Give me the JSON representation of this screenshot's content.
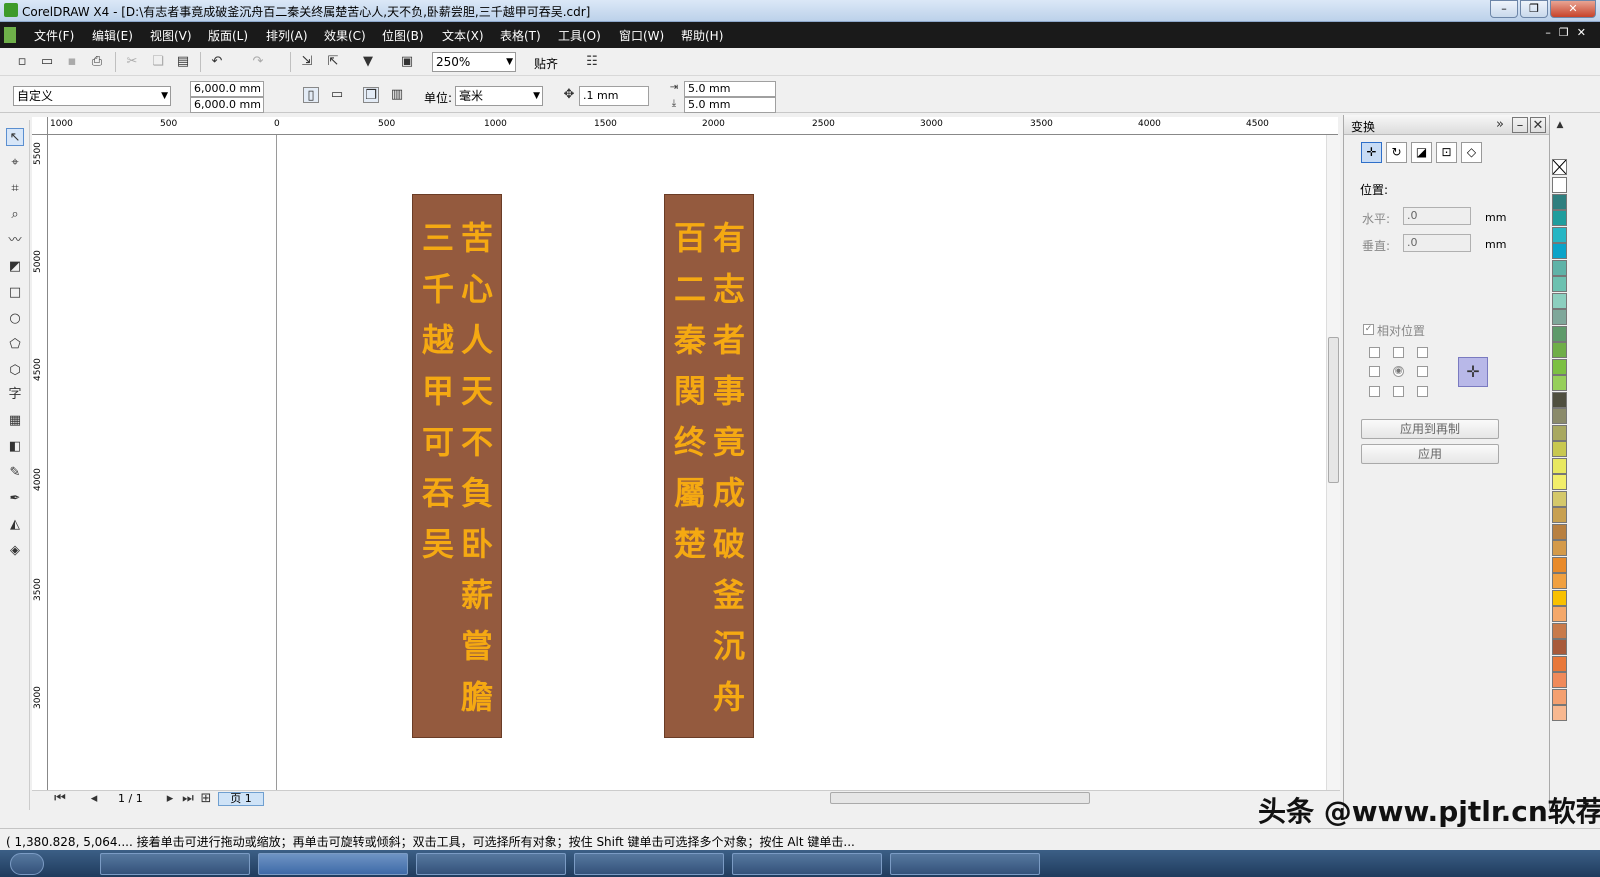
{
  "window": {
    "title": "CorelDRAW X4 - [D:\\有志者事竟成破釜沉舟百二秦关终属楚苦心人,天不负,卧薪尝胆,三千越甲可吞吴.cdr]"
  },
  "menu": [
    "文件(F)",
    "编辑(E)",
    "视图(V)",
    "版面(L)",
    "排列(A)",
    "效果(C)",
    "位图(B)",
    "文本(X)",
    "表格(T)",
    "工具(O)",
    "窗口(W)",
    "帮助(H)"
  ],
  "toolbar": {
    "zoom": "250%",
    "snap_label": "贴齐"
  },
  "property_bar": {
    "paper_preset": "自定义",
    "width": "6,000.0 mm",
    "height": "6,000.0 mm",
    "units_label": "单位:",
    "units": "毫米",
    "nudge": ".1 mm",
    "dup_x": "5.0 mm",
    "dup_y": "5.0 mm"
  },
  "ruler_h": [
    "1000",
    "500",
    "0",
    "500",
    "1000",
    "1500",
    "2000",
    "2500",
    "3000",
    "3500",
    "4000",
    "4500"
  ],
  "ruler_v": [
    "5500",
    "5000",
    "4500",
    "4000",
    "3500",
    "3000"
  ],
  "couplet_left": {
    "col_right": [
      "苦",
      "心",
      "人",
      "天",
      "不",
      "負",
      "卧",
      "薪",
      "嘗",
      "膽"
    ],
    "col_left": [
      "三",
      "千",
      "越",
      "甲",
      "可",
      "吞",
      "吴"
    ]
  },
  "couplet_right": {
    "col_right": [
      "有",
      "志",
      "者",
      "事",
      "竟",
      "成",
      "破",
      "釜",
      "沉",
      "舟"
    ],
    "col_left": [
      "百",
      "二",
      "秦",
      "関",
      "终",
      "屬",
      "楚"
    ]
  },
  "page_nav": {
    "page_count": "1 / 1",
    "page_tab": "页 1"
  },
  "docker": {
    "title": "变换",
    "position_label": "位置:",
    "h_label": "水平:",
    "h_value": ".0",
    "v_label": "垂直:",
    "v_value": ".0",
    "unit": "mm",
    "relative_label": "相对位置",
    "apply_dup": "应用到再制",
    "apply": "应用"
  },
  "palette_colors": [
    "#ffffff",
    "#2e7f7f",
    "#1f9d9d",
    "#26b6c4",
    "#0aa3c8",
    "#5fb3a8",
    "#6cc1b0",
    "#8ccfbf",
    "#7fa79a",
    "#5e9a6a",
    "#6fae48",
    "#7cc043",
    "#96cf5a",
    "#4f4f3f",
    "#8a8a6a",
    "#a8a860",
    "#c8c850",
    "#e8e860",
    "#f2ee6a",
    "#d4c86a",
    "#c8a050",
    "#b88040",
    "#d49a4a",
    "#e88a2a",
    "#f0a040",
    "#f8c000",
    "#f4a86a",
    "#c87a4a",
    "#a85a3a",
    "#e8783a",
    "#f08a5a",
    "#f4a070",
    "#f8b890"
  ],
  "status": {
    "text": "( 1,380.828, 5,064....   接着单击可进行拖动或缩放；再单击可旋转或倾斜；双击工具，可选择所有对象；按住 Shift 键单击可选择多个对象；按住 Alt 键单击..."
  },
  "watermark": "头条 @www.pjtlr.cn软荐网"
}
